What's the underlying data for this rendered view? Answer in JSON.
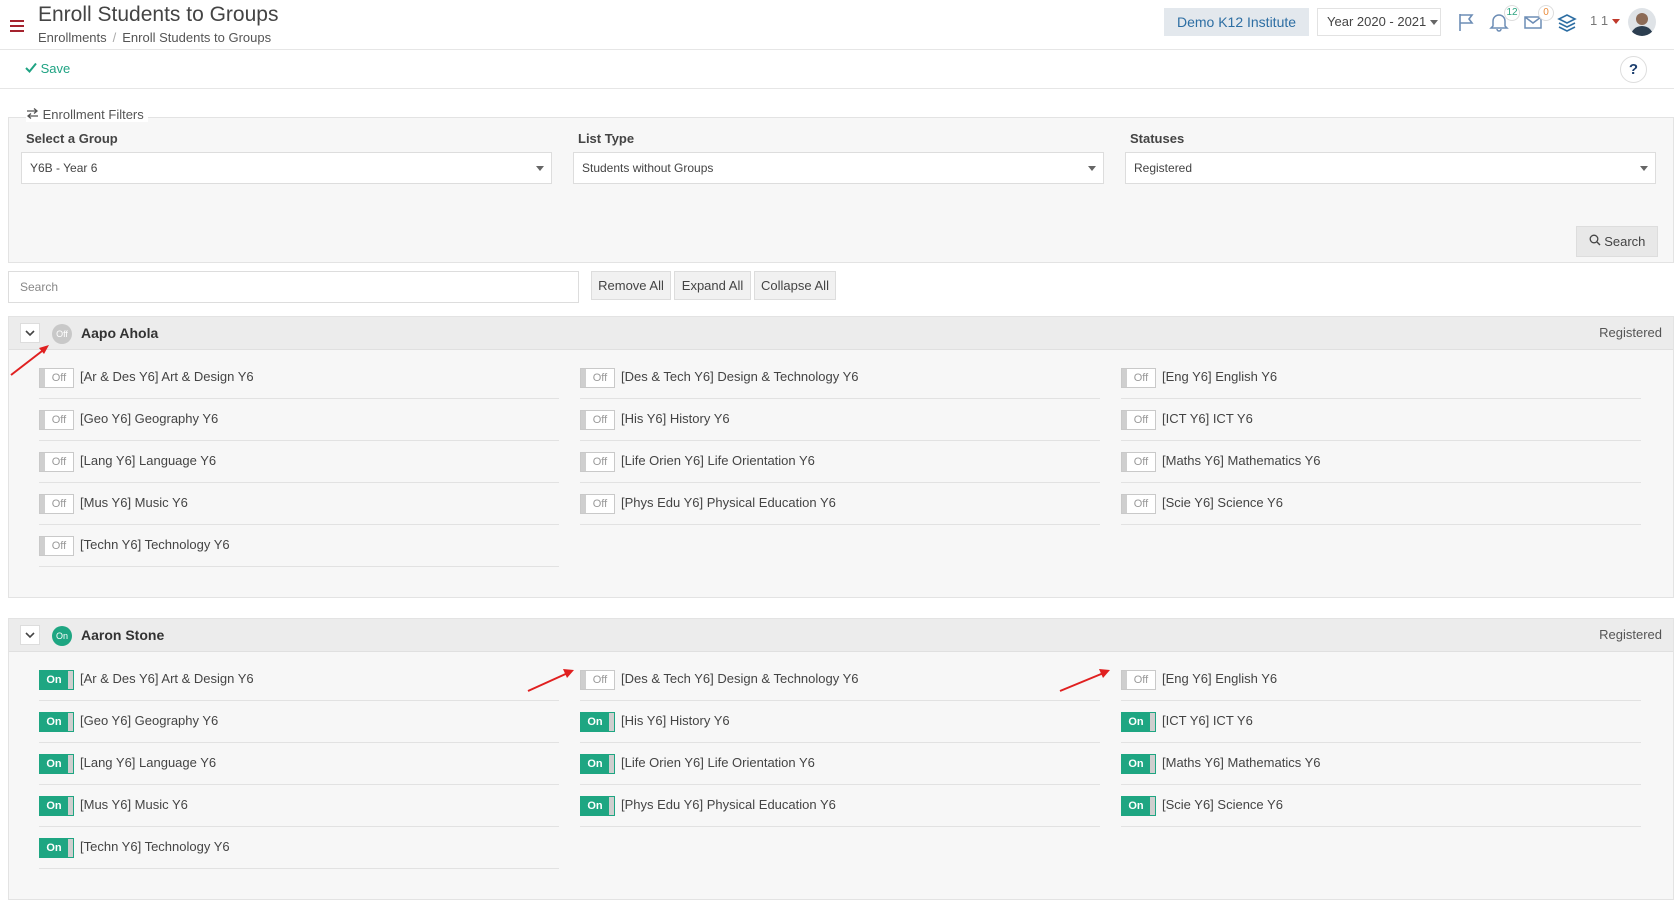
{
  "header": {
    "title": "Enroll Students to Groups",
    "breadcrumb": [
      "Enrollments",
      "Enroll Students to Groups"
    ],
    "institute": "Demo K12 Institute",
    "year": "Year 2020 - 2021",
    "notifications_count": "12",
    "messages_count": "0",
    "user_label": "1 1"
  },
  "toolbar": {
    "save_label": "Save",
    "help_label": "?"
  },
  "filters": {
    "legend": "Enrollment Filters",
    "group_label": "Select a Group",
    "group_value": "Y6B - Year 6",
    "list_type_label": "List Type",
    "list_type_value": "Students without Groups",
    "statuses_label": "Statuses",
    "statuses_value": "Registered",
    "search_button": "Search"
  },
  "list_controls": {
    "search_placeholder": "Search",
    "remove_all": "Remove All",
    "expand_all": "Expand All",
    "collapse_all": "Collapse All"
  },
  "students": [
    {
      "name": "Aapo Ahola",
      "toggle": "Off",
      "status": "Registered",
      "courses": [
        {
          "label": "[Ar & Des Y6] Art & Design Y6",
          "state": "Off"
        },
        {
          "label": "[Des & Tech Y6] Design & Technology Y6",
          "state": "Off"
        },
        {
          "label": "[Eng Y6] English Y6",
          "state": "Off"
        },
        {
          "label": "[Geo Y6] Geography Y6",
          "state": "Off"
        },
        {
          "label": "[His Y6] History Y6",
          "state": "Off"
        },
        {
          "label": "[ICT Y6] ICT Y6",
          "state": "Off"
        },
        {
          "label": "[Lang Y6] Language Y6",
          "state": "Off"
        },
        {
          "label": "[Life Orien Y6] Life Orientation Y6",
          "state": "Off"
        },
        {
          "label": "[Maths Y6] Mathematics Y6",
          "state": "Off"
        },
        {
          "label": "[Mus Y6] Music Y6",
          "state": "Off"
        },
        {
          "label": "[Phys Edu Y6] Physical Education Y6",
          "state": "Off"
        },
        {
          "label": "[Scie Y6] Science Y6",
          "state": "Off"
        },
        {
          "label": "[Techn Y6] Technology Y6",
          "state": "Off"
        }
      ]
    },
    {
      "name": "Aaron Stone",
      "toggle": "On",
      "status": "Registered",
      "courses": [
        {
          "label": "[Ar & Des Y6] Art & Design Y6",
          "state": "On"
        },
        {
          "label": "[Des & Tech Y6] Design & Technology Y6",
          "state": "Off"
        },
        {
          "label": "[Eng Y6] English Y6",
          "state": "Off"
        },
        {
          "label": "[Geo Y6] Geography Y6",
          "state": "On"
        },
        {
          "label": "[His Y6] History Y6",
          "state": "On"
        },
        {
          "label": "[ICT Y6] ICT Y6",
          "state": "On"
        },
        {
          "label": "[Lang Y6] Language Y6",
          "state": "On"
        },
        {
          "label": "[Life Orien Y6] Life Orientation Y6",
          "state": "On"
        },
        {
          "label": "[Maths Y6] Mathematics Y6",
          "state": "On"
        },
        {
          "label": "[Mus Y6] Music Y6",
          "state": "On"
        },
        {
          "label": "[Phys Edu Y6] Physical Education Y6",
          "state": "On"
        },
        {
          "label": "[Scie Y6] Science Y6",
          "state": "On"
        },
        {
          "label": "[Techn Y6] Technology Y6",
          "state": "On"
        }
      ]
    }
  ],
  "colors": {
    "accent_green": "#1ea682",
    "brand_red": "#a5232e",
    "annotation_red": "#e02020"
  }
}
